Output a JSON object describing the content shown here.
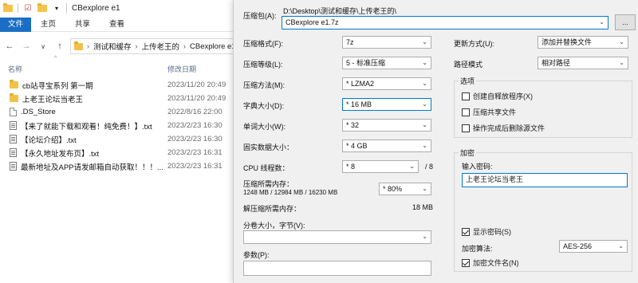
{
  "explorer": {
    "window_title": "CBexplore e1",
    "ribbon_tabs": [
      "文件",
      "主页",
      "共享",
      "查看"
    ],
    "breadcrumbs": [
      "测试和缓存",
      "上传老王的",
      "CBexplore e1"
    ],
    "columns": {
      "name": "名称",
      "date": "修改日期"
    },
    "files": [
      {
        "type": "folder",
        "name": "cb站寻宝系列 第一期",
        "date": "2023/11/20 20:49"
      },
      {
        "type": "folder",
        "name": "上老王论坛当老王",
        "date": "2023/11/20 20:49"
      },
      {
        "type": "file",
        "name": ".DS_Store",
        "date": "2022/8/16 22:00"
      },
      {
        "type": "txt",
        "name": "【来了就能下载和观看！纯免费！】.txt",
        "date": "2023/2/23 16:30"
      },
      {
        "type": "txt",
        "name": "【论坛介绍】.txt",
        "date": "2023/2/23 16:30"
      },
      {
        "type": "txt",
        "name": "【永久地址发布页】.txt",
        "date": "2023/2/23 16:31"
      },
      {
        "type": "txt",
        "name": "最新地址及APP请发邮箱自动获取！！！...",
        "date": "2023/2/23 16:31"
      }
    ]
  },
  "dialog": {
    "archive_label": "压缩包(A):",
    "archive_path": "D:\\Desktop\\测试和缓存\\上传老王的\\",
    "archive_name": "CBexplore e1.7z",
    "browse_label": "...",
    "format_label": "压缩格式(F):",
    "format_value": "7z",
    "level_label": "压缩等级(L):",
    "level_value": "5 - 标准压缩",
    "method_label": "压缩方法(M):",
    "method_value": "* LZMA2",
    "dict_label": "字典大小(D):",
    "dict_value": "* 16 MB",
    "word_label": "单词大小(W):",
    "word_value": "* 32",
    "solid_label": "固实数据大小：",
    "solid_value": "* 4 GB",
    "threads_label": "CPU 线程数：",
    "threads_value": "* 8",
    "threads_total": "/ 8",
    "mem_compress_label": "压缩所需内存：",
    "mem_compress_detail": "1248 MB / 12984 MB / 16230 MB",
    "mem_compress_value": "* 80%",
    "mem_decompress_label": "解压缩所需内存：",
    "mem_decompress_value": "18 MB",
    "split_label": "分卷大小，字节(V):",
    "split_value": "",
    "params_label": "参数(P):",
    "params_value": "",
    "update_label": "更新方式(U):",
    "update_value": "添加并替换文件",
    "path_label": "路径模式",
    "path_value": "相对路径",
    "options_title": "选项",
    "options": [
      {
        "label": "创建自释放程序(X)",
        "checked": false
      },
      {
        "label": "压缩共享文件",
        "checked": false
      },
      {
        "label": "操作完成后删除源文件",
        "checked": false
      }
    ],
    "encrypt_title": "加密",
    "password_label": "输入密码:",
    "password_value": "上老王论坛当老王",
    "show_password_label": "显示密码(S)",
    "show_password_checked": true,
    "enc_method_label": "加密算法:",
    "enc_method_value": "AES-256",
    "encrypt_names_label": "加密文件名(N)",
    "encrypt_names_checked": true
  }
}
